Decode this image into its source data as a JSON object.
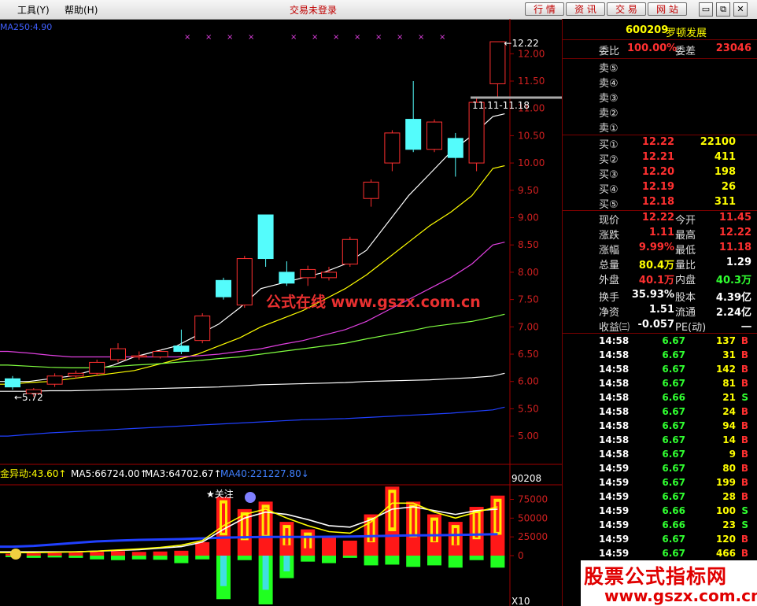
{
  "menu": {
    "tools": "工具(Y)",
    "help": "帮助(H)"
  },
  "title": "交易未登录",
  "toolbar": {
    "market": "行 情",
    "info": "资 讯",
    "trade": "交 易",
    "web": "网 站"
  },
  "window_buttons": {
    "restore": "restore-icon",
    "minimize": "minimize-icon",
    "close": "close-icon"
  },
  "stock": {
    "code": "600209",
    "name": "罗顿发展"
  },
  "order_book": {
    "weibi_label": "委比",
    "weibi_value": "100.00%",
    "weicha_label": "委差",
    "weicha_value": "23046",
    "sells": [
      "卖⑤",
      "卖④",
      "卖③",
      "卖②",
      "卖①"
    ],
    "buys": [
      {
        "label": "买①",
        "price": "12.22",
        "vol": "22100"
      },
      {
        "label": "买②",
        "price": "12.21",
        "vol": "411"
      },
      {
        "label": "买③",
        "price": "12.20",
        "vol": "198"
      },
      {
        "label": "买④",
        "price": "12.19",
        "vol": "26"
      },
      {
        "label": "买⑤",
        "price": "12.18",
        "vol": "311"
      }
    ]
  },
  "quote": [
    {
      "l1": "现价",
      "v1": "12.22",
      "c1": "#ff3030",
      "l2": "今开",
      "v2": "11.45",
      "c2": "#ff3030"
    },
    {
      "l1": "涨跌",
      "v1": "1.11",
      "c1": "#ff3030",
      "l2": "最高",
      "v2": "12.22",
      "c2": "#ff3030"
    },
    {
      "l1": "涨幅",
      "v1": "9.99%",
      "c1": "#ff3030",
      "l2": "最低",
      "v2": "11.18",
      "c2": "#ff3030"
    },
    {
      "l1": "总量",
      "v1": "80.4万",
      "c1": "#ffff00",
      "l2": "量比",
      "v2": "1.29",
      "c2": "#ffffff"
    },
    {
      "l1": "外盘",
      "v1": "40.1万",
      "c1": "#ff3030",
      "l2": "内盘",
      "v2": "40.3万",
      "c2": "#30ff30"
    },
    {
      "l1": "换手",
      "v1": "35.93%",
      "c1": "#ffffff",
      "l2": "股本",
      "v2": "4.39亿",
      "c2": "#ffffff"
    },
    {
      "l1": "净资",
      "v1": "1.51",
      "c1": "#ffffff",
      "l2": "流通",
      "v2": "2.24亿",
      "c2": "#ffffff"
    },
    {
      "l1": "收益㈢",
      "v1": "-0.057",
      "c1": "#ffffff",
      "l2": "PE(动)",
      "v2": "一",
      "c2": "#ffffff"
    }
  ],
  "ticks": [
    {
      "t": "14:58",
      "p": "6.67",
      "v": "137",
      "d": "B"
    },
    {
      "t": "14:58",
      "p": "6.67",
      "v": "31",
      "d": "B"
    },
    {
      "t": "14:58",
      "p": "6.67",
      "v": "142",
      "d": "B"
    },
    {
      "t": "14:58",
      "p": "6.67",
      "v": "81",
      "d": "B"
    },
    {
      "t": "14:58",
      "p": "6.66",
      "v": "21",
      "d": "S"
    },
    {
      "t": "14:58",
      "p": "6.67",
      "v": "24",
      "d": "B"
    },
    {
      "t": "14:58",
      "p": "6.67",
      "v": "94",
      "d": "B"
    },
    {
      "t": "14:58",
      "p": "6.67",
      "v": "14",
      "d": "B"
    },
    {
      "t": "14:58",
      "p": "6.67",
      "v": "9",
      "d": "B"
    },
    {
      "t": "14:59",
      "p": "6.67",
      "v": "80",
      "d": "B"
    },
    {
      "t": "14:59",
      "p": "6.67",
      "v": "199",
      "d": "B"
    },
    {
      "t": "14:59",
      "p": "6.67",
      "v": "28",
      "d": "B"
    },
    {
      "t": "14:59",
      "p": "6.66",
      "v": "100",
      "d": "S"
    },
    {
      "t": "14:59",
      "p": "6.66",
      "v": "23",
      "d": "S"
    },
    {
      "t": "14:59",
      "p": "6.67",
      "v": "120",
      "d": "B"
    },
    {
      "t": "14:59",
      "p": "6.67",
      "v": "466",
      "d": "B"
    }
  ],
  "watermark": {
    "text": "公式在线 www.gszx.com.cn",
    "big": "股票公式指标网",
    "url": "www.gszx.com.cn"
  },
  "chart_data": {
    "type": "candlestick",
    "ma_label": "MA250:4.90",
    "yticks": [
      "12.00",
      "11.50",
      "11.00",
      "10.50",
      "10.00",
      "9.50",
      "9.00",
      "8.50",
      "8.00",
      "7.50",
      "7.00",
      "6.50",
      "6.00",
      "5.50",
      "5.00"
    ],
    "ylim": [
      4.8,
      12.35
    ],
    "high_label": "12.22",
    "low_label": "5.72",
    "range_label": "11.11-11.18",
    "candles": [
      {
        "o": 6.05,
        "c": 5.9,
        "h": 6.1,
        "l": 5.85
      },
      {
        "o": 5.78,
        "c": 5.85,
        "h": 5.88,
        "l": 5.72
      },
      {
        "o": 5.95,
        "c": 6.1,
        "h": 6.15,
        "l": 5.9
      },
      {
        "o": 6.1,
        "c": 6.15,
        "h": 6.2,
        "l": 6.05
      },
      {
        "o": 6.15,
        "c": 6.35,
        "h": 6.4,
        "l": 6.1
      },
      {
        "o": 6.4,
        "c": 6.6,
        "h": 6.7,
        "l": 6.35
      },
      {
        "o": 6.45,
        "c": 6.47,
        "h": 6.55,
        "l": 6.4
      },
      {
        "o": 6.45,
        "c": 6.55,
        "h": 6.58,
        "l": 6.42
      },
      {
        "o": 6.65,
        "c": 6.55,
        "h": 6.95,
        "l": 6.5
      },
      {
        "o": 6.75,
        "c": 7.2,
        "h": 7.25,
        "l": 6.7
      },
      {
        "o": 7.85,
        "c": 7.55,
        "h": 7.9,
        "l": 7.5
      },
      {
        "o": 7.4,
        "c": 8.25,
        "h": 8.3,
        "l": 7.35
      },
      {
        "o": 9.05,
        "c": 8.25,
        "h": 9.05,
        "l": 8.1
      },
      {
        "o": 8.0,
        "c": 7.8,
        "h": 8.2,
        "l": 7.75
      },
      {
        "o": 7.9,
        "c": 8.05,
        "h": 8.12,
        "l": 7.75
      },
      {
        "o": 7.9,
        "c": 8.0,
        "h": 8.1,
        "l": 7.85
      },
      {
        "o": 8.15,
        "c": 8.6,
        "h": 8.65,
        "l": 8.1
      },
      {
        "o": 9.35,
        "c": 9.65,
        "h": 9.7,
        "l": 9.2
      },
      {
        "o": 10.0,
        "c": 10.55,
        "h": 10.6,
        "l": 9.85
      },
      {
        "o": 10.8,
        "c": 10.25,
        "h": 11.5,
        "l": 10.2
      },
      {
        "o": 10.25,
        "c": 10.75,
        "h": 10.8,
        "l": 10.2
      },
      {
        "o": 10.45,
        "c": 10.1,
        "h": 10.55,
        "l": 9.75
      },
      {
        "o": 10.0,
        "c": 11.11,
        "h": 11.2,
        "l": 9.85
      },
      {
        "o": 11.45,
        "c": 12.22,
        "h": 12.22,
        "l": 11.18
      }
    ],
    "ma_lines": [
      {
        "color": "#ffffff",
        "vals": [
          6.0,
          6.0,
          6.05,
          6.1,
          6.2,
          6.3,
          6.45,
          6.55,
          6.65,
          6.85,
          7.05,
          7.35,
          7.7,
          7.8,
          7.9,
          8.0,
          8.15,
          8.4,
          8.9,
          9.4,
          9.8,
          10.2,
          10.5,
          10.85
        ]
      },
      {
        "color": "#ffff00",
        "vals": [
          5.95,
          5.98,
          6.0,
          6.05,
          6.1,
          6.15,
          6.2,
          6.3,
          6.4,
          6.5,
          6.65,
          6.8,
          7.0,
          7.15,
          7.3,
          7.5,
          7.7,
          7.95,
          8.25,
          8.55,
          8.85,
          9.1,
          9.4,
          9.9
        ]
      },
      {
        "color": "#e040e0",
        "vals": [
          6.55,
          6.52,
          6.48,
          6.45,
          6.45,
          6.45,
          6.45,
          6.45,
          6.45,
          6.47,
          6.5,
          6.55,
          6.6,
          6.68,
          6.75,
          6.85,
          6.95,
          7.1,
          7.3,
          7.5,
          7.7,
          7.9,
          8.15,
          8.5
        ]
      },
      {
        "color": "#80ff40",
        "vals": [
          6.3,
          6.28,
          6.26,
          6.25,
          6.25,
          6.27,
          6.3,
          6.32,
          6.35,
          6.38,
          6.42,
          6.45,
          6.5,
          6.55,
          6.6,
          6.65,
          6.7,
          6.78,
          6.85,
          6.92,
          7.0,
          7.05,
          7.1,
          7.18
        ]
      },
      {
        "color": "#ffffff",
        "vals": [
          5.82,
          5.82,
          5.83,
          5.83,
          5.84,
          5.85,
          5.86,
          5.87,
          5.88,
          5.89,
          5.9,
          5.92,
          5.94,
          5.95,
          5.96,
          5.97,
          5.98,
          6.0,
          6.01,
          6.02,
          6.03,
          6.05,
          6.07,
          6.1
        ]
      },
      {
        "color": "#2040ff",
        "vals": [
          5.0,
          5.03,
          5.06,
          5.08,
          5.1,
          5.12,
          5.14,
          5.16,
          5.18,
          5.2,
          5.22,
          5.24,
          5.26,
          5.28,
          5.3,
          5.31,
          5.32,
          5.34,
          5.36,
          5.38,
          5.4,
          5.42,
          5.45,
          5.48
        ]
      }
    ],
    "sub": {
      "labels": [
        {
          "text": "金异动:43.60↑",
          "color": "#ffff00"
        },
        {
          "text": "MA5:66724.00↑",
          "color": "#ffffff"
        },
        {
          "text": "MA3:64702.67↑",
          "color": "#ffffff"
        },
        {
          "text": "MA40:221227.80↓",
          "color": "#4080ff"
        }
      ],
      "max_label": "90208",
      "yticks": [
        "75000",
        "50000",
        "25000",
        "0"
      ],
      "ylim_top": 90208,
      "annotation": "★关注",
      "bottom_label": "X10",
      "bars_up": [
        2500,
        3000,
        3500,
        4000,
        5000,
        6000,
        5000,
        5500,
        6500,
        18000,
        78000,
        62000,
        72000,
        45000,
        35000,
        25000,
        20000,
        55000,
        92000,
        72000,
        55000,
        45000,
        65000,
        80000
      ],
      "bars_down": [
        -2000,
        -3000,
        -2500,
        -3000,
        -5000,
        -6000,
        -5000,
        -5500,
        -10000,
        -5000,
        -58000,
        -6000,
        -65000,
        -30000,
        -8000,
        -10000,
        -3000,
        -13000,
        -12000,
        -15000,
        -13000,
        -16000,
        -6000,
        -16000
      ],
      "ma_white": [
        5000,
        5000,
        5000,
        5000,
        6000,
        7000,
        8000,
        10000,
        12000,
        18000,
        35000,
        50000,
        58000,
        55000,
        48000,
        40000,
        38000,
        48000,
        62000,
        65000,
        60000,
        55000,
        60000,
        62000
      ],
      "ma_yellow": [
        4000,
        4000,
        4500,
        5000,
        6000,
        7500,
        9000,
        11000,
        14000,
        20000,
        40000,
        55000,
        62000,
        50000,
        40000,
        32000,
        30000,
        45000,
        70000,
        70000,
        58000,
        50000,
        58000,
        65000
      ],
      "ma_blue": [
        12000,
        13000,
        15000,
        17000,
        19000,
        20000,
        21000,
        21500,
        22000,
        23000,
        24000,
        24500,
        25000,
        25000,
        25000,
        25200,
        25500,
        26000,
        26500,
        27000,
        27200,
        27500,
        28000,
        28500
      ]
    }
  }
}
